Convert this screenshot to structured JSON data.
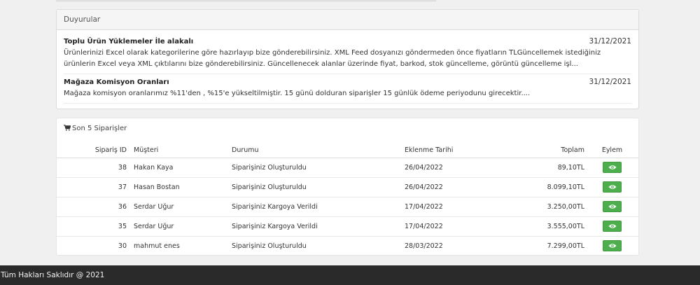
{
  "announcements": {
    "heading": "Duyurular",
    "items": [
      {
        "title": "Toplu Ürün Yüklemeler İle alakalı",
        "date": "31/12/2021",
        "body": "Ürünlerinizi Excel olarak kategorilerine göre hazırlayıp bize gönderebilirsiniz. XML Feed dosyanızı göndermeden önce fiyatların TLGüncellemek istediğiniz ürünlerin Excel veya XML çıktılarını bize gönderebilirsiniz. Güncellenecek alanlar üzerinde fiyat, barkod, stok güncelleme, görüntü güncelleme işl..."
      },
      {
        "title": "Mağaza Komisyon Oranları",
        "date": "31/12/2021",
        "body": "Mağaza komisyon oranlarımız %11'den , %15'e yükseltilmiştir. 15 günü dolduran siparişler 15 günlük ödeme periyodunu girecektir...."
      }
    ]
  },
  "orders": {
    "heading": "Son 5 Siparişler",
    "heading_icon": "shopping-cart-icon",
    "columns": [
      "Sipariş ID",
      "Müşteri",
      "Durumu",
      "Eklenme Tarihi",
      "Toplam",
      "Eylem"
    ],
    "rows": [
      {
        "id": "38",
        "customer": "Hakan Kaya",
        "status": "Siparişiniz Oluşturuldu",
        "date": "26/04/2022",
        "total": "89,10TL"
      },
      {
        "id": "37",
        "customer": "Hasan Bostan",
        "status": "Siparişiniz Oluşturuldu",
        "date": "26/04/2022",
        "total": "8.099,10TL"
      },
      {
        "id": "36",
        "customer": "Serdar Uğur",
        "status": "Siparişiniz Kargoya Verildi",
        "date": "17/04/2022",
        "total": "3.250,00TL"
      },
      {
        "id": "35",
        "customer": "Serdar Uğur",
        "status": "Siparişiniz Kargoya Verildi",
        "date": "17/04/2022",
        "total": "3.555,00TL"
      },
      {
        "id": "30",
        "customer": "mahmut enes",
        "status": "Siparişiniz Oluşturuldu",
        "date": "28/03/2022",
        "total": "7.299,00TL"
      }
    ],
    "action_icon": "eye-icon",
    "action_color": "#4cae4c"
  },
  "footer": {
    "text": "Tüm Hakları Saklıdır @ 2021"
  }
}
